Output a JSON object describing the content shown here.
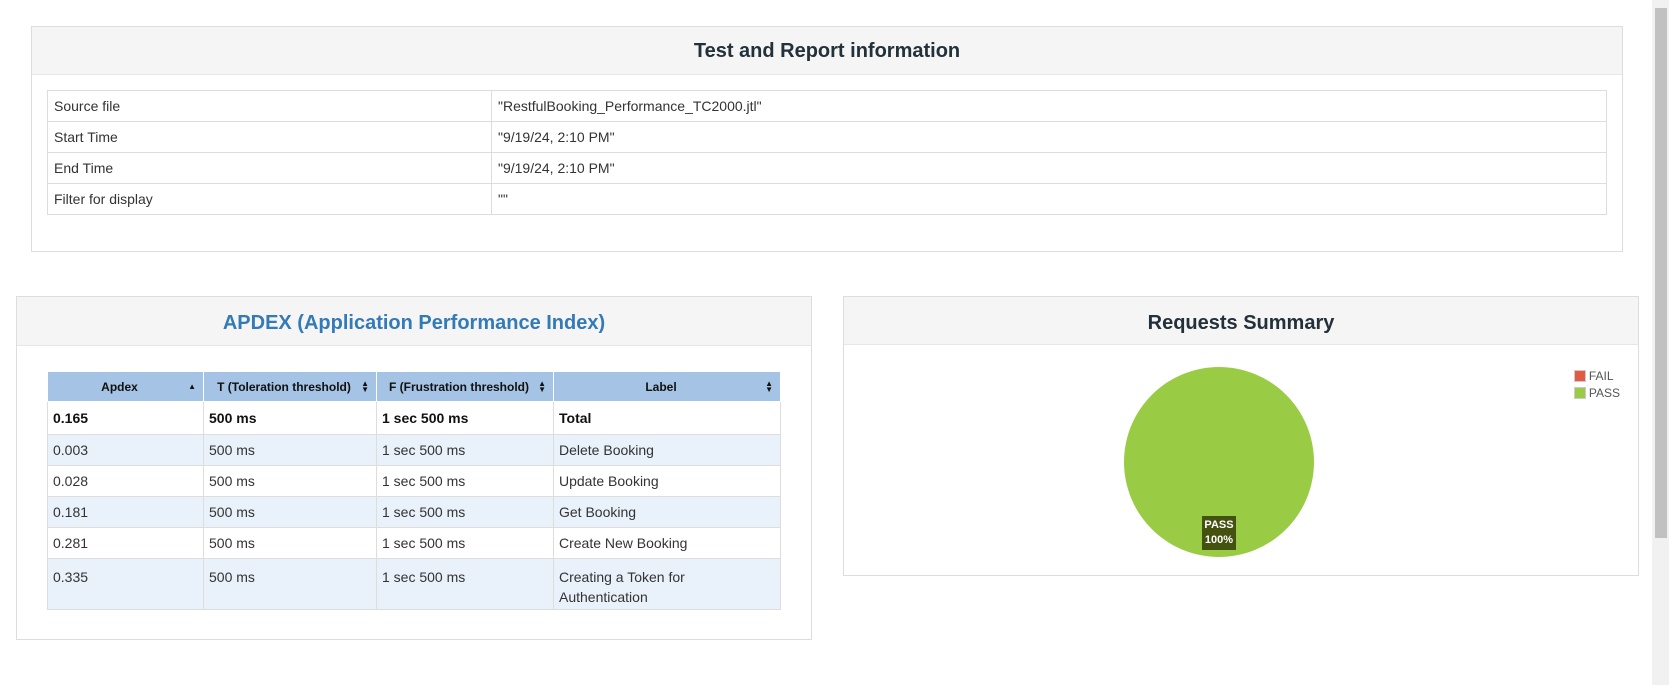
{
  "info": {
    "title": "Test and Report information",
    "rows": [
      {
        "key": "Source file",
        "value": "\"RestfulBooking_Performance_TC2000.jtl\""
      },
      {
        "key": "Start Time",
        "value": "\"9/19/24, 2:10 PM\""
      },
      {
        "key": "End Time",
        "value": "\"9/19/24, 2:10 PM\""
      },
      {
        "key": "Filter for display",
        "value": "\"\""
      }
    ]
  },
  "apdex": {
    "title": "APDEX (Application Performance Index)",
    "headers": [
      "Apdex",
      "T (Toleration threshold)",
      "F (Frustration threshold)",
      "Label"
    ],
    "sort_icons": [
      "sort-asc-icon",
      "sort-both-icon",
      "sort-both-icon",
      "sort-both-icon"
    ],
    "rows": [
      [
        "0.165",
        "500 ms",
        "1 sec 500 ms",
        "Total"
      ],
      [
        "0.003",
        "500 ms",
        "1 sec 500 ms",
        "Delete Booking"
      ],
      [
        "0.028",
        "500 ms",
        "1 sec 500 ms",
        "Update Booking"
      ],
      [
        "0.181",
        "500 ms",
        "1 sec 500 ms",
        "Get Booking"
      ],
      [
        "0.281",
        "500 ms",
        "1 sec 500 ms",
        "Create New Booking"
      ],
      [
        "0.335",
        "500 ms",
        "1 sec 500 ms",
        "Creating a Token for Authentication"
      ]
    ]
  },
  "summary": {
    "title": "Requests Summary",
    "legend": [
      {
        "label": "FAIL",
        "color": "#e25a42"
      },
      {
        "label": "PASS",
        "color": "#9acb44"
      }
    ],
    "pie_label_name": "PASS",
    "pie_label_pct": "100%"
  },
  "chart_data": {
    "type": "pie",
    "title": "Requests Summary",
    "categories": [
      "FAIL",
      "PASS"
    ],
    "values": [
      0,
      100
    ],
    "colors": [
      "#e25a42",
      "#9acb44"
    ],
    "legend_position": "top-right"
  }
}
